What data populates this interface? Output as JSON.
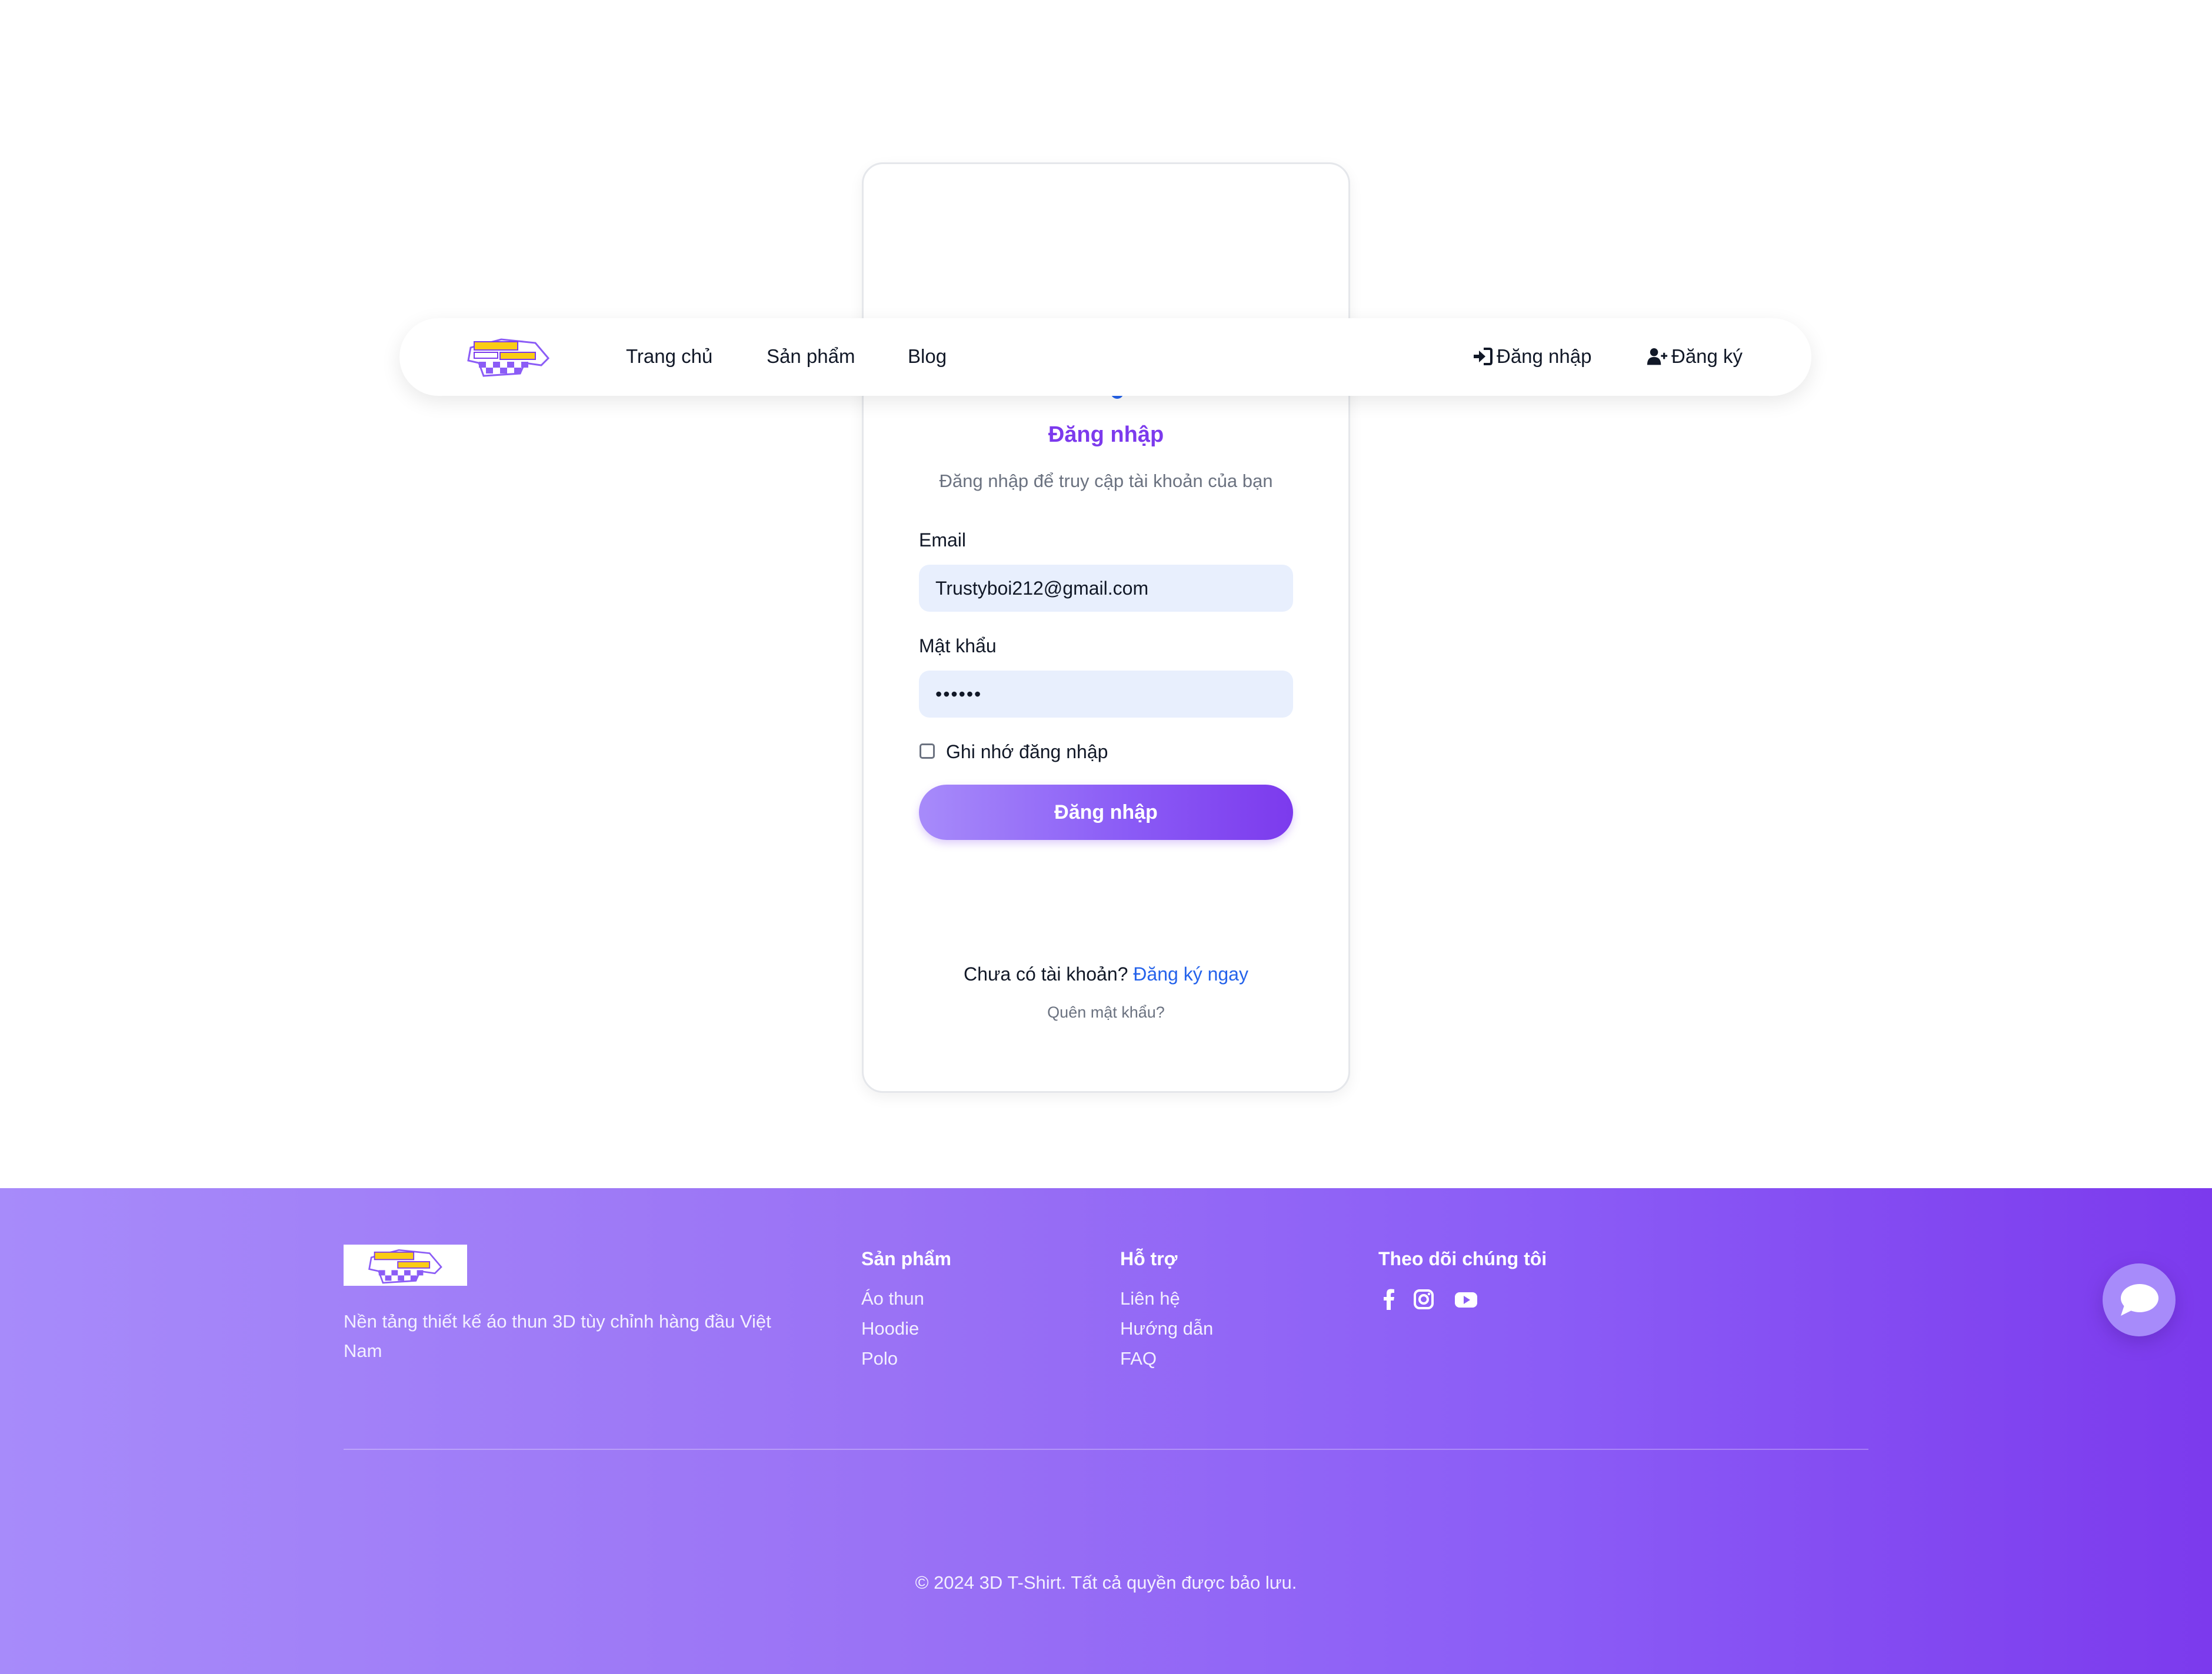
{
  "brand": {
    "logo_icon": "checkered-tshirt-logo",
    "colors": {
      "primary": "#7c3aed",
      "primary_light": "#a78bfa",
      "link": "#2563eb",
      "input_bg": "#e8effd"
    }
  },
  "navbar": {
    "links": [
      "Trang chủ",
      "Sản phẩm",
      "Blog"
    ],
    "login_label": "Đăng nhập",
    "login_icon": "sign-in-icon",
    "register_label": "Đăng ký",
    "register_icon": "user-plus-icon"
  },
  "login": {
    "title": "Đăng nhập",
    "subtitle": "Đăng nhập để truy cập tài khoản của bạn",
    "email_label": "Email",
    "email_value": "Trustyboi212@gmail.com",
    "password_label": "Mật khẩu",
    "password_value": "••••••",
    "remember_label": "Ghi nhớ đăng nhập",
    "remember_checked": false,
    "submit_label": "Đăng nhập",
    "no_account_text": "Chưa có tài khoản?",
    "register_link": "Đăng ký ngay",
    "forgot_link": "Quên mật khẩu?"
  },
  "footer": {
    "description": "Nền tảng thiết kế áo thun 3D tùy chỉnh hàng đầu Việt Nam",
    "columns": [
      {
        "heading": "Sản phẩm",
        "links": [
          "Áo thun",
          "Hoodie",
          "Polo"
        ]
      },
      {
        "heading": "Hỗ trợ",
        "links": [
          "Liên hệ",
          "Hướng dẫn",
          "FAQ"
        ]
      },
      {
        "heading": "Theo dõi chúng tôi",
        "links": []
      }
    ],
    "social_icons": [
      "facebook-icon",
      "instagram-icon",
      "youtube-icon"
    ],
    "copyright": "© 2024 3D T-Shirt. Tất cả quyền được bảo lưu."
  },
  "chat_widget": {
    "icon": "chat-bubble-icon"
  }
}
